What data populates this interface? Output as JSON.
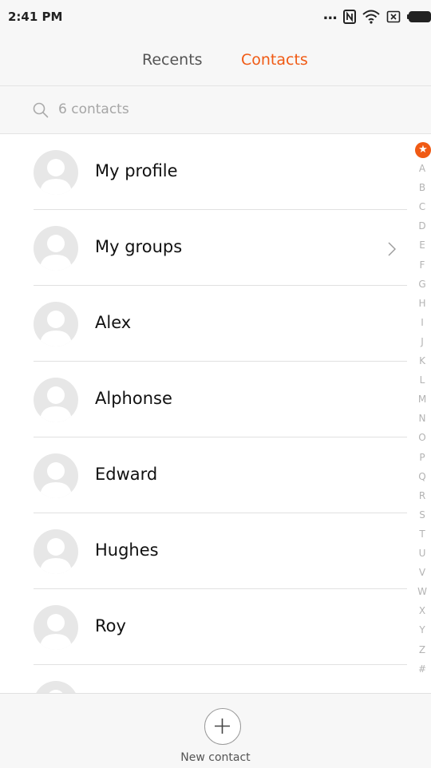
{
  "status_bar": {
    "time": "2:41 PM",
    "icons": [
      "more-dots-icon",
      "nfc-icon",
      "wifi-icon",
      "sim-off-icon",
      "battery-icon"
    ],
    "dots": "..."
  },
  "tabs": [
    {
      "label": "Recents",
      "active": false
    },
    {
      "label": "Contacts",
      "active": true
    }
  ],
  "search": {
    "placeholder": "6 contacts"
  },
  "rows": [
    {
      "name": "My profile"
    },
    {
      "name": "My groups"
    },
    {
      "name": "Alex"
    },
    {
      "name": "Alphonse"
    },
    {
      "name": "Edward"
    },
    {
      "name": "Hughes"
    },
    {
      "name": "Roy"
    }
  ],
  "index": {
    "star": "★",
    "letters": [
      "A",
      "B",
      "C",
      "D",
      "E",
      "F",
      "G",
      "H",
      "I",
      "J",
      "K",
      "L",
      "M",
      "N",
      "O",
      "P",
      "Q",
      "R",
      "S",
      "T",
      "U",
      "V",
      "W",
      "X",
      "Y",
      "Z",
      "#"
    ]
  },
  "bottom": {
    "new_contact_label": "New contact"
  },
  "colors": {
    "accent": "#f05a14",
    "background": "#f7f7f7"
  }
}
